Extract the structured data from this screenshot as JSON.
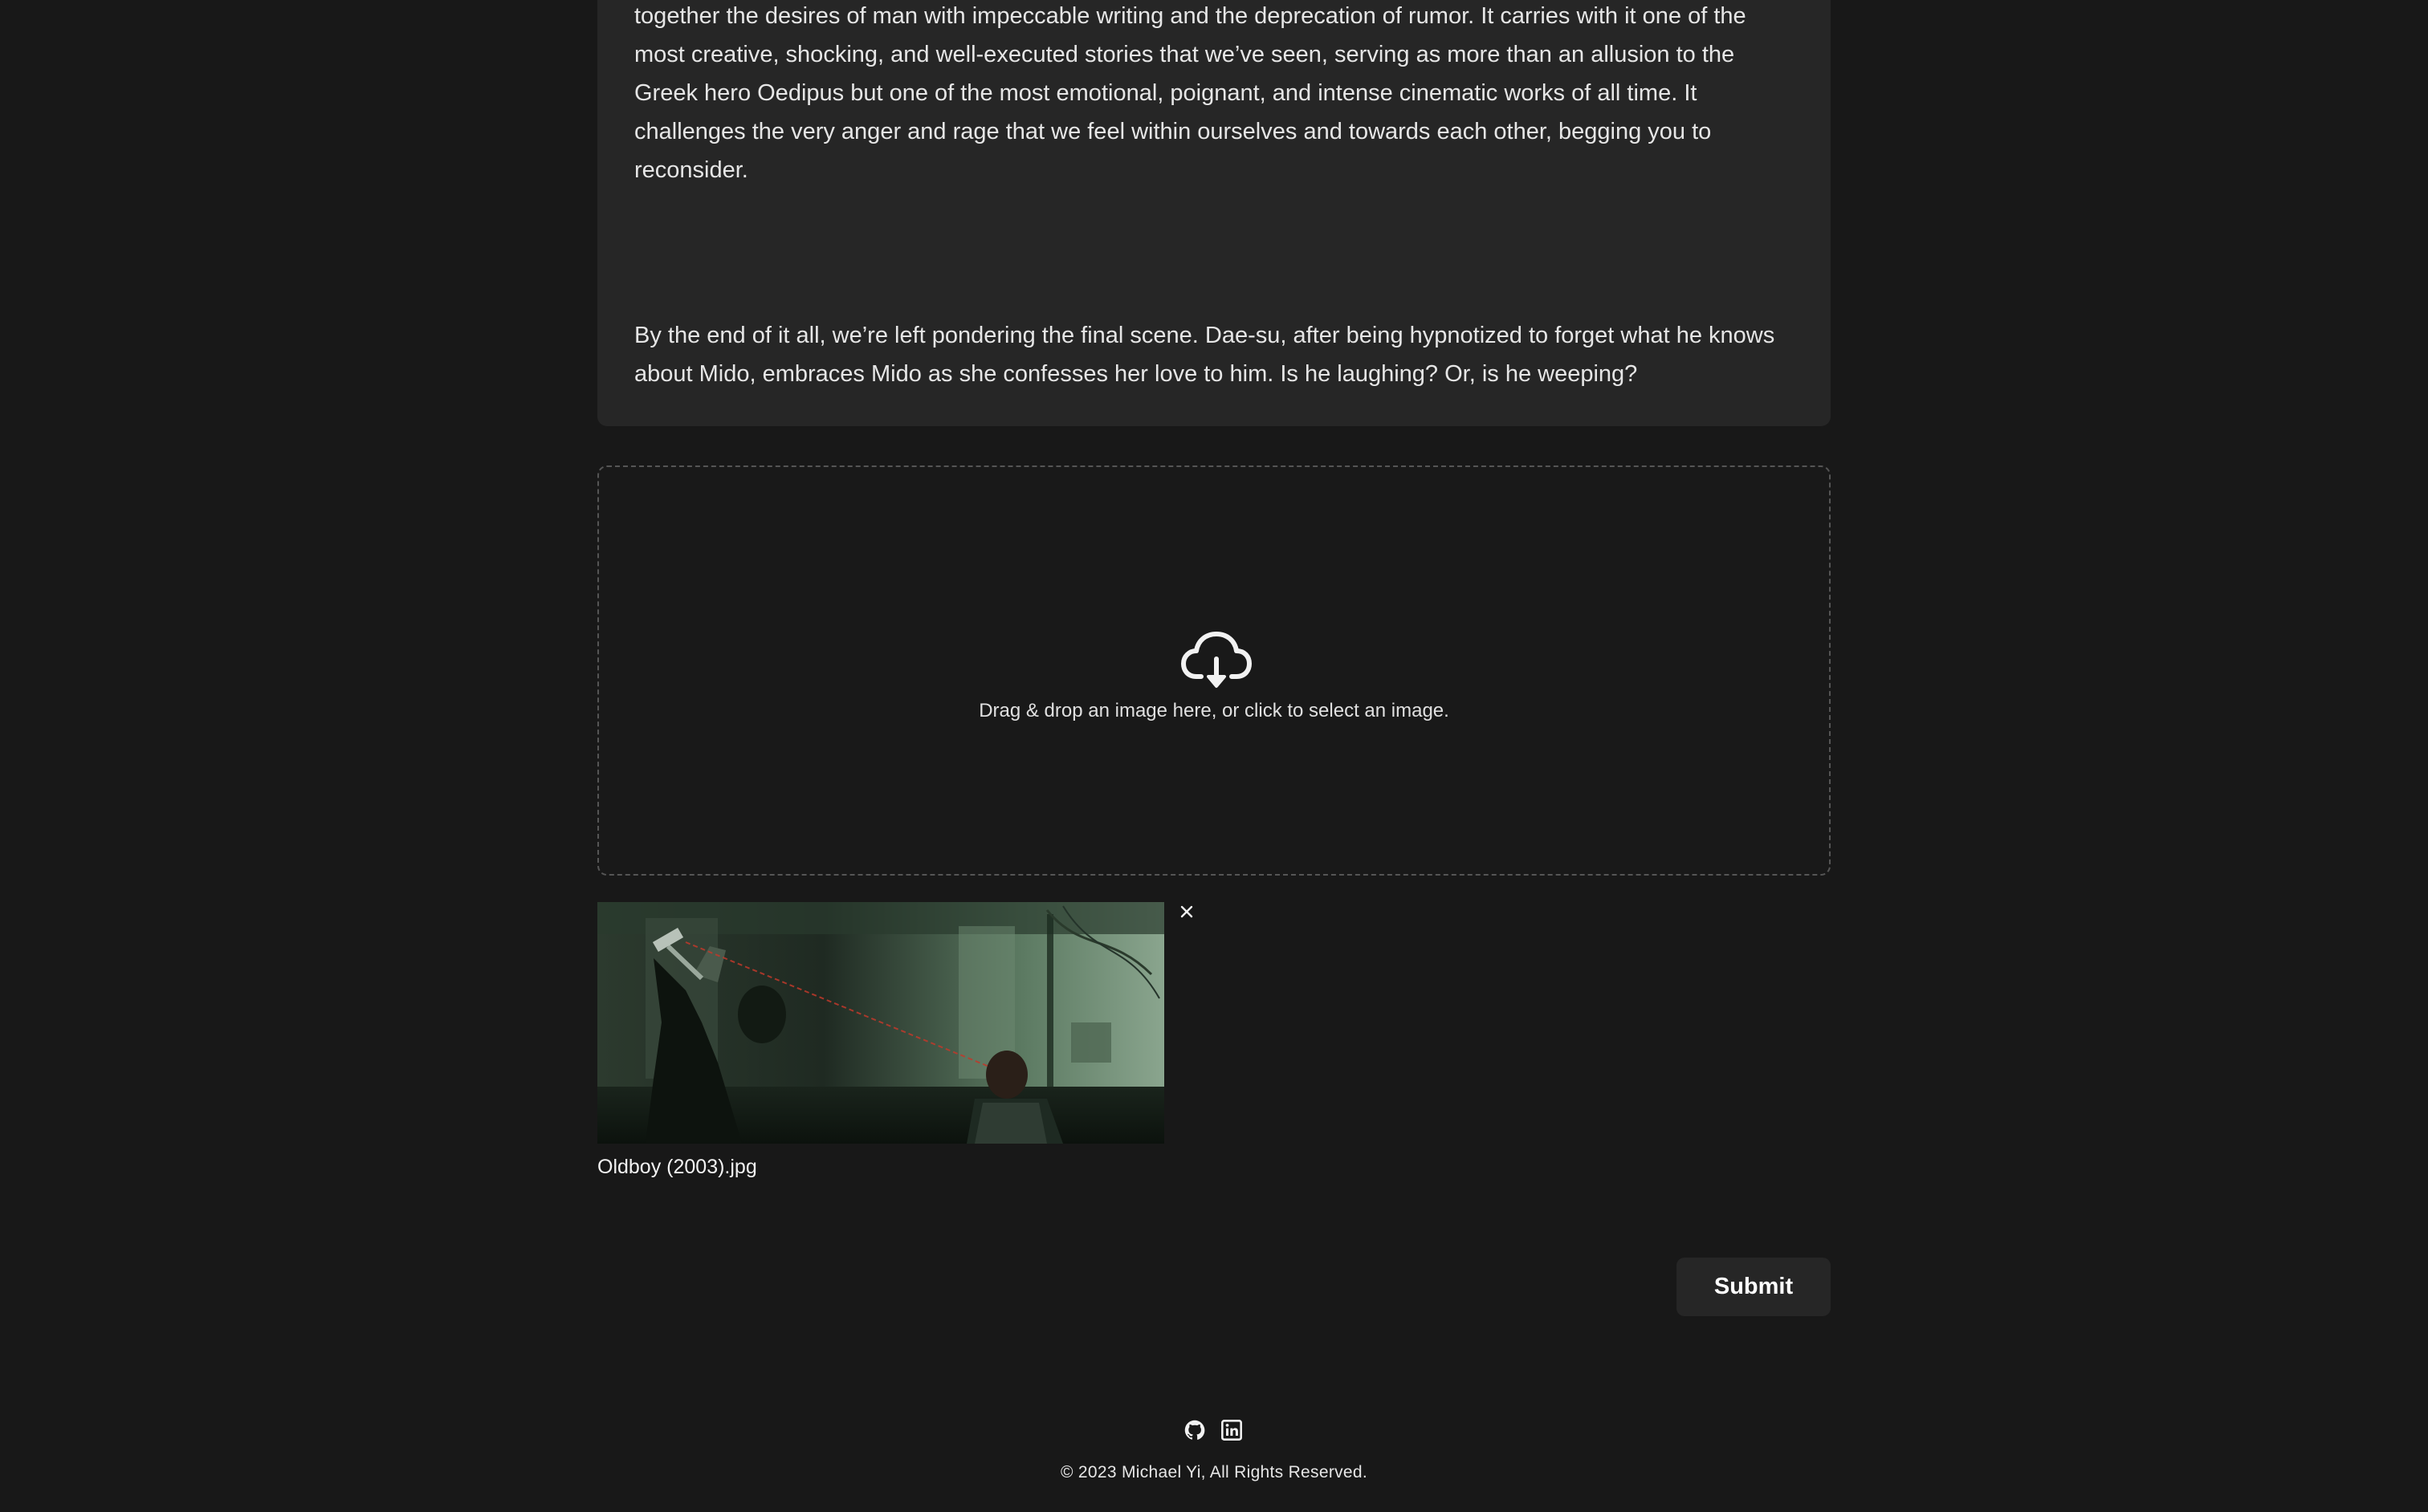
{
  "review": {
    "paragraph_1": "together the desires of man with impeccable writing and the deprecation of rumor. It carries with it one of the most creative, shocking, and well-executed stories that we’ve seen, serving as more than an allusion to the Greek hero Oedipus but one of the most emotional, poignant, and intense cinematic works of all time. It challenges the very anger and rage that we feel within ourselves and towards each other, begging you to reconsider.",
    "paragraph_2": "By the end of it all, we’re left pondering the final scene. Dae-su, after being hypnotized to forget what he knows about Mido, embraces Mido as she confesses her love to him. Is he laughing? Or, is he weeping?"
  },
  "upload": {
    "icon": "cloud-download-icon",
    "instruction": "Drag & drop an image here, or click to select an image.",
    "file_name": "Oldboy (2003).jpg",
    "remove_icon": "close-icon"
  },
  "actions": {
    "submit_label": "Submit"
  },
  "footer": {
    "icons": [
      "github-icon",
      "linkedin-icon"
    ],
    "copyright": "© 2023 Michael Yi, All Rights Reserved."
  },
  "colors": {
    "background": "#181818",
    "card": "#262626",
    "text": "#e6e6e6",
    "dashed_border": "#555555"
  }
}
